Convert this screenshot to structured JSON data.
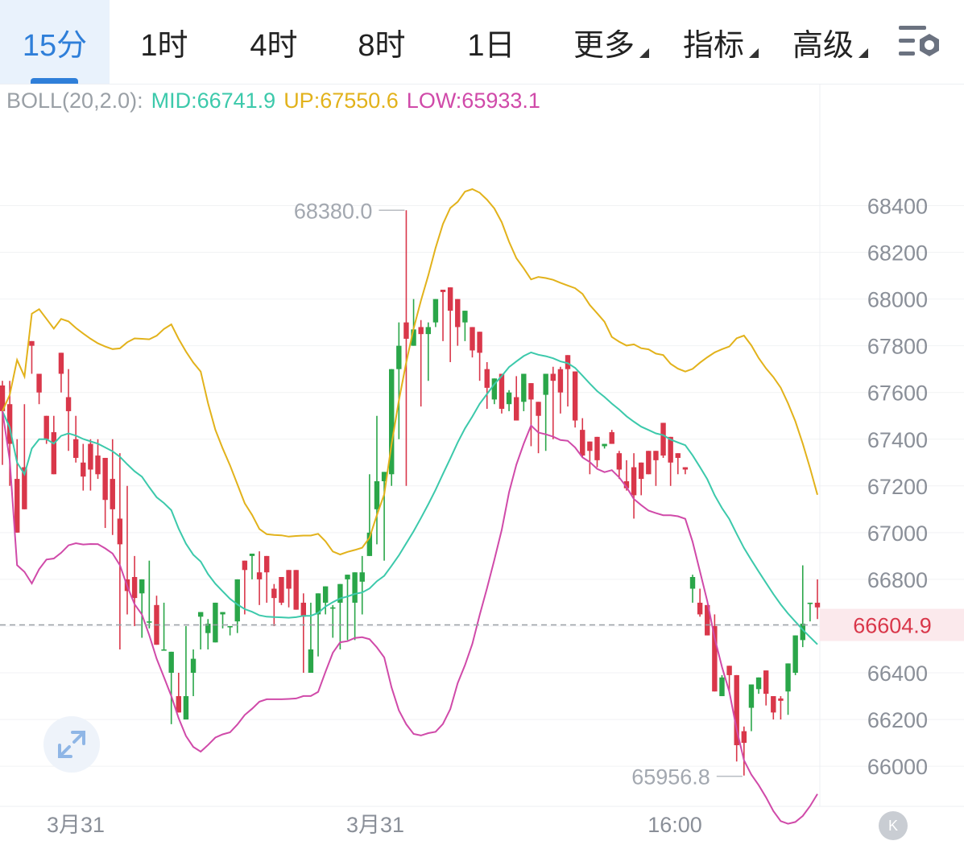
{
  "tabs": [
    {
      "label": "15分",
      "active": true
    },
    {
      "label": "1时"
    },
    {
      "label": "4时"
    },
    {
      "label": "8时"
    },
    {
      "label": "1日"
    },
    {
      "label": "更多",
      "dropdown": true
    },
    {
      "label": "指标",
      "dropdown": true
    },
    {
      "label": "高级",
      "dropdown": true
    }
  ],
  "settings_icon": "settings-gear-icon",
  "legend": {
    "name": "BOLL(20,2.0):",
    "mid": "MID:66741.9",
    "up": "UP:67550.6",
    "low": "LOW:65933.1"
  },
  "colors": {
    "up_candle": "#2aa649",
    "down_candle": "#d9374a",
    "mid_line": "#3cc9ab",
    "up_line": "#e2b21b",
    "low_line": "#d04aa9",
    "accent": "#2f7fd9"
  },
  "chart_data": {
    "type": "candlestick",
    "y_axis": {
      "min": 65900,
      "max": 68500,
      "ticks": [
        66000,
        66200,
        66400,
        66600,
        66800,
        67000,
        67200,
        67400,
        67600,
        67800,
        68000,
        68200,
        68400
      ]
    },
    "x_axis": {
      "labels": [
        "3月31",
        "3月31",
        "16:00"
      ]
    },
    "current_price": 66604.9,
    "current_price_label": "66604.9",
    "high_marker": {
      "value": 68380.0,
      "label": "68380.0"
    },
    "low_marker": {
      "value": 65956.8,
      "label": "65956.8"
    },
    "candles": [
      [
        67630,
        67650,
        67520,
        67290
      ],
      [
        67550,
        67650,
        67380,
        67200
      ],
      [
        67230,
        67400,
        67000,
        67050
      ],
      [
        67280,
        67550,
        67100,
        67180
      ],
      [
        67820,
        67720,
        67800,
        67680
      ],
      [
        67680,
        67520,
        67600,
        67550
      ],
      [
        67500,
        67300,
        67400,
        67380
      ],
      [
        67430,
        67500,
        67250,
        67350
      ],
      [
        67770,
        67580,
        67680,
        67600
      ],
      [
        67580,
        67700,
        67520,
        67350
      ],
      [
        67400,
        67500,
        67320,
        67300
      ],
      [
        67300,
        67380,
        67240,
        67180
      ],
      [
        67380,
        67400,
        67270,
        67180
      ],
      [
        67330,
        67400,
        67250,
        67230
      ],
      [
        67320,
        67300,
        67140,
        67020
      ],
      [
        67230,
        67400,
        67100,
        66990
      ],
      [
        67060,
        67340,
        66950,
        66500
      ],
      [
        66800,
        67200,
        66750,
        66650
      ],
      [
        66810,
        66900,
        66720,
        66600
      ],
      [
        66740,
        66750,
        66800,
        66550
      ],
      [
        66620,
        66880,
        66620,
        66590
      ],
      [
        66690,
        66730,
        66520,
        66520
      ],
      [
        66500,
        66700,
        66500,
        66500
      ],
      [
        66400,
        66400,
        66490,
        66180
      ],
      [
        66300,
        66400,
        66230,
        66240
      ],
      [
        66200,
        66600,
        66300,
        66270
      ],
      [
        66400,
        66500,
        66460,
        66300
      ],
      [
        66640,
        66580,
        66660,
        66500
      ],
      [
        66570,
        66630,
        66610,
        66500
      ],
      [
        66530,
        66600,
        66700,
        66600
      ],
      [
        66650,
        66630,
        66660,
        66590
      ],
      [
        66600,
        66600,
        66600,
        66560
      ],
      [
        66620,
        66700,
        66800,
        66570
      ],
      [
        66880,
        66780,
        66840,
        66650
      ],
      [
        66900,
        66800,
        66910,
        66800
      ],
      [
        66830,
        66920,
        66800,
        66690
      ],
      [
        66900,
        66760,
        66830,
        66700
      ],
      [
        66760,
        66780,
        66720,
        66600
      ],
      [
        66810,
        66750,
        66700,
        66690
      ],
      [
        66840,
        66780,
        66760,
        66680
      ],
      [
        66840,
        66760,
        66670,
        66680
      ],
      [
        66700,
        66740,
        66640,
        66400
      ],
      [
        66400,
        66700,
        66500,
        66420
      ],
      [
        66650,
        66710,
        66740,
        66470
      ],
      [
        66700,
        66720,
        66770,
        66650
      ],
      [
        66680,
        66690,
        66680,
        66550
      ],
      [
        66700,
        66780,
        66780,
        66500
      ],
      [
        66800,
        66800,
        66820,
        66540
      ],
      [
        66700,
        66750,
        66830,
        66540
      ],
      [
        66790,
        66900,
        66830,
        66650
      ],
      [
        66900,
        67250,
        67000,
        66900
      ],
      [
        67100,
        67500,
        67220,
        66950
      ],
      [
        67220,
        67190,
        67260,
        66880
      ],
      [
        67250,
        67450,
        67700,
        67200
      ],
      [
        67700,
        67900,
        67800,
        67400
      ],
      [
        67900,
        68380,
        67830,
        67200
      ],
      [
        67800,
        68000,
        67870,
        67840
      ],
      [
        67880,
        67910,
        67850,
        67540
      ],
      [
        67850,
        67900,
        67880,
        67650
      ],
      [
        67900,
        67950,
        68000,
        67880
      ],
      [
        68040,
        68000,
        68030,
        67820
      ],
      [
        68050,
        68020,
        67950,
        67730
      ],
      [
        68000,
        67900,
        67880,
        67800
      ],
      [
        67900,
        67950,
        67950,
        67820
      ],
      [
        67880,
        67850,
        67780,
        67750
      ],
      [
        67860,
        67800,
        67770,
        67650
      ],
      [
        67700,
        67730,
        67620,
        67530
      ],
      [
        67570,
        67630,
        67660,
        67550
      ],
      [
        67680,
        67630,
        67530,
        67510
      ],
      [
        67550,
        67610,
        67600,
        67520
      ],
      [
        67580,
        67670,
        67480,
        67480
      ],
      [
        67560,
        67610,
        67680,
        67520
      ],
      [
        67640,
        67610,
        67570,
        67370
      ],
      [
        67560,
        67560,
        67500,
        67340
      ],
      [
        67590,
        67620,
        67680,
        67350
      ],
      [
        67680,
        67710,
        67650,
        67400
      ],
      [
        67700,
        67710,
        67600,
        67510
      ],
      [
        67760,
        67640,
        67700,
        67540
      ],
      [
        67690,
        67660,
        67480,
        67450
      ],
      [
        67440,
        67490,
        67330,
        67320
      ],
      [
        67390,
        67380,
        67350,
        67250
      ],
      [
        67410,
        67410,
        67310,
        67280
      ],
      [
        67370,
        67380,
        67380,
        67360
      ],
      [
        67430,
        67440,
        67380,
        67380
      ],
      [
        67340,
        67350,
        67270,
        67230
      ],
      [
        67220,
        67310,
        67190,
        67180
      ],
      [
        67280,
        67340,
        67160,
        67060
      ],
      [
        67300,
        67290,
        67230,
        67160
      ],
      [
        67350,
        67280,
        67250,
        67250
      ],
      [
        67350,
        67320,
        67310,
        67200
      ],
      [
        67470,
        67460,
        67330,
        67320
      ],
      [
        67410,
        67320,
        67300,
        67200
      ],
      [
        67340,
        67320,
        67320,
        67250
      ],
      [
        67280,
        67280,
        67270,
        67250
      ],
      [
        66760,
        66820,
        66810,
        66700
      ],
      [
        66700,
        66760,
        66650,
        66640
      ],
      [
        66690,
        66660,
        66560,
        66570
      ],
      [
        66600,
        66650,
        66320,
        66320
      ],
      [
        66300,
        66390,
        66380,
        66340
      ],
      [
        66430,
        66350,
        66390,
        66320
      ],
      [
        66390,
        66360,
        66090,
        66020
      ],
      [
        66150,
        66170,
        66100,
        65960
      ],
      [
        66250,
        66230,
        66350,
        66150
      ],
      [
        66330,
        66310,
        66380,
        66310
      ],
      [
        66410,
        66350,
        66310,
        66260
      ],
      [
        66300,
        66220,
        66230,
        66200
      ],
      [
        66290,
        66300,
        66280,
        66200
      ],
      [
        66320,
        66340,
        66440,
        66220
      ],
      [
        66400,
        66410,
        66560,
        66390
      ],
      [
        66540,
        66860,
        66610,
        66510
      ],
      [
        66700,
        66700,
        66700,
        66620
      ],
      [
        66700,
        66800,
        66680,
        66630
      ]
    ]
  }
}
